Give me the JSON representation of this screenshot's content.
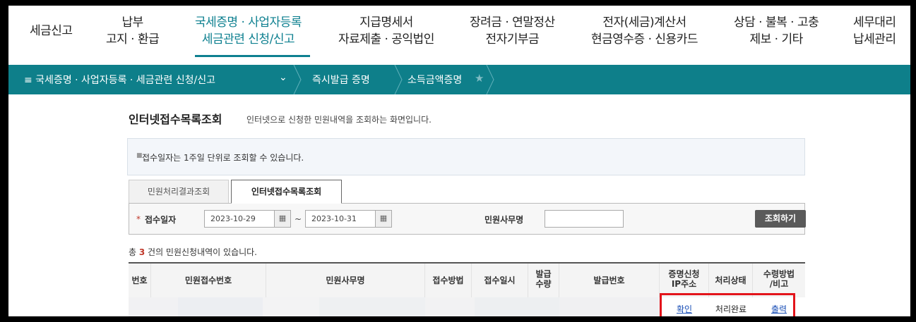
{
  "topnav": {
    "items": [
      {
        "line1": "세금신고",
        "line2": ""
      },
      {
        "line1": "납부",
        "line2": "고지 · 환급"
      },
      {
        "line1": "국세증명 · 사업자등록",
        "line2": "세금관련 신청/신고"
      },
      {
        "line1": "지급명세서",
        "line2": "자료제출 · 공익법인"
      },
      {
        "line1": "장려금 · 연말정산",
        "line2": "전자기부금"
      },
      {
        "line1": "전자(세금)계산서",
        "line2": "현금영수증 · 신용카드"
      },
      {
        "line1": "상담 · 불복 · 고충",
        "line2": "제보 · 기타"
      },
      {
        "line1": "세무대리",
        "line2": "납세관리"
      }
    ]
  },
  "breadcrumb": {
    "menu_label": "≡  국세증명 · 사업자등록 · 세금관련 신청/신고",
    "dropdown": "⌄",
    "crumb1": "즉시발급 증명",
    "crumb2": "소득금액증명",
    "star": "★"
  },
  "page": {
    "title": "인터넷접수목록조회",
    "description": "인터넷으로 신청한 민원내역을 조회하는 화면입니다.",
    "notice": "접수일자는 1주일 단위로 조회할 수 있습니다."
  },
  "tabs": {
    "inactive": "민원처리결과조회",
    "active": "인터넷접수목록조회"
  },
  "search": {
    "required_mark": "*",
    "date_label": "접수일자",
    "start_date": "2023-10-29",
    "end_date": "2023-10-31",
    "tilde": "~",
    "calendar_icon": "▦",
    "office_label": "민원사무명",
    "office_value": "",
    "button": "조회하기"
  },
  "result": {
    "prefix": "총 ",
    "count": "3",
    "suffix": " 건의 민원신청내역이 있습니다."
  },
  "table": {
    "headers": [
      "번호",
      "민원접수번호",
      "민원사무명",
      "접수방법",
      "접수일시",
      "발급\n수량",
      "발급번호",
      "증명신청\nIP주소",
      "처리상태",
      "수령방법\n/비고"
    ],
    "row": {
      "ip": "확인",
      "status": "처리완료",
      "receive": "출력"
    }
  },
  "colors": {
    "accent": "#0e8090",
    "bar": "#0e7f8a",
    "highlight": "#e3141b"
  }
}
